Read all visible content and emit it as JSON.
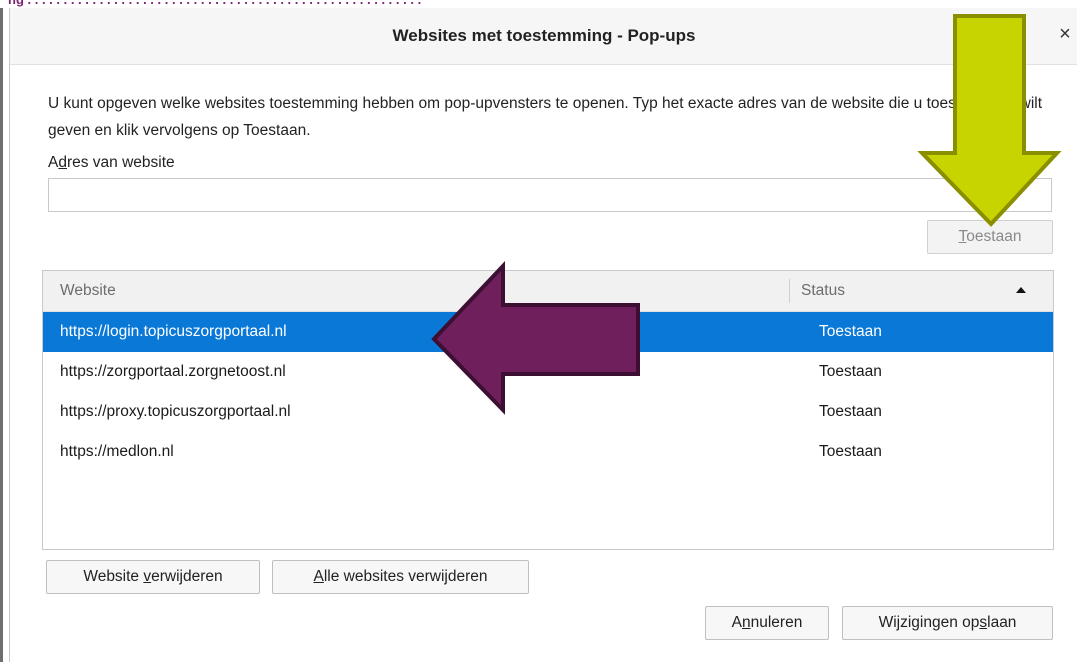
{
  "dialog": {
    "title": "Websites met toestemming - Pop-ups",
    "close_glyph": "×",
    "description": "U kunt opgeven welke websites toestemming hebben om pop-upvensters te openen. Typ het exacte adres van de website die u toestemming wilt geven en klik vervolgens op Toestaan.",
    "address_label": "Adres van website",
    "address_value": "",
    "allow_button": "Toestaan"
  },
  "table": {
    "columns": [
      "Website",
      "Status"
    ],
    "sort_direction": "ascending",
    "rows": [
      {
        "website": "https://login.topicuszorgportaal.nl",
        "status": "Toestaan",
        "selected": true
      },
      {
        "website": "https://zorgportaal.zorgnetoost.nl",
        "status": "Toestaan",
        "selected": false
      },
      {
        "website": "https://proxy.topicuszorgportaal.nl",
        "status": "Toestaan",
        "selected": false
      },
      {
        "website": "https://medlon.nl",
        "status": "Toestaan",
        "selected": false
      }
    ]
  },
  "actions": {
    "remove_website": "Website verwijderen",
    "remove_all": "Alle websites verwijderen",
    "cancel": "Annuleren",
    "save": "Wijzigingen opslaan"
  },
  "annotations": {
    "yellow_arrow_color": "#c8d400",
    "yellow_arrow_outline": "#8a8f00",
    "purple_arrow_color": "#6e1f5c",
    "purple_arrow_outline": "#3d0f33"
  },
  "colors": {
    "selection": "#0a78d7"
  }
}
